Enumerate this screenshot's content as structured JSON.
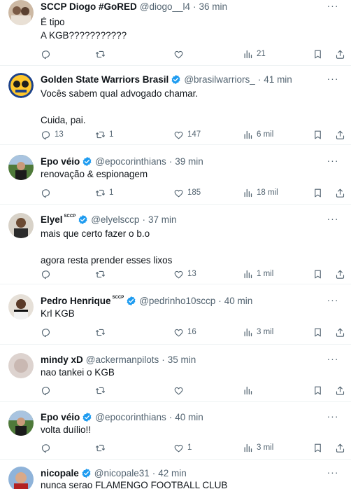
{
  "tweets": [
    {
      "name": "SCCP Diogo #GoRED",
      "handle": "@diogo__l4",
      "time": "36 min",
      "verified": false,
      "text": "É tipo\nA KGB???????????",
      "replies": "",
      "retweets": "",
      "likes": "",
      "views": "21"
    },
    {
      "name": "Golden State Warriors Brasil",
      "handle": "@brasilwarriors_",
      "time": "41 min",
      "verified": true,
      "text": "Vocês sabem qual advogado chamar.\n\nCuida, pai.",
      "replies": "13",
      "retweets": "1",
      "likes": "147",
      "views": "6 mil"
    },
    {
      "name": "Epo véio",
      "handle": "@epocorinthians",
      "time": "39 min",
      "verified": true,
      "text": "renovação & espionagem",
      "replies": "",
      "retweets": "1",
      "likes": "185",
      "views": "18 mil"
    },
    {
      "name": "Elyel",
      "name_tag": "SCCP",
      "handle": "@elyelsccp",
      "time": "37 min",
      "verified": true,
      "text": "mais que certo fazer o b.o\n\nagora resta prender esses lixos",
      "replies": "",
      "retweets": "",
      "likes": "13",
      "views": "1 mil"
    },
    {
      "name": "Pedro Henrique",
      "name_tag": "SCCP",
      "handle": "@pedrinho10sccp",
      "time": "40 min",
      "verified": true,
      "text": "Krl KGB",
      "replies": "",
      "retweets": "",
      "likes": "16",
      "views": "3 mil"
    },
    {
      "name": "mindy xD",
      "handle": "@ackermanpilots",
      "time": "35 min",
      "verified": false,
      "text": "nao tankei o KGB",
      "replies": "",
      "retweets": "",
      "likes": "",
      "views": ""
    },
    {
      "name": "Epo véio",
      "handle": "@epocorinthians",
      "time": "40 min",
      "verified": true,
      "text": "volta duílio!!",
      "replies": "",
      "retweets": "",
      "likes": "1",
      "views": "3 mil"
    },
    {
      "name": "nicopale",
      "handle": "@nicopale31",
      "time": "42 min",
      "verified": true,
      "text": "nunca serao FLAMENGO FOOTBALL CLUB"
    }
  ],
  "icons": {
    "more": "more-icon",
    "reply": "reply-icon",
    "retweet": "retweet-icon",
    "like": "heart-icon",
    "views": "views-icon",
    "bookmark": "bookmark-icon",
    "share": "share-icon",
    "verified": "verified-badge-icon"
  },
  "colors": {
    "verified": "#1d9bf0",
    "secondary_text": "#536471",
    "divider": "#eff3f4"
  }
}
